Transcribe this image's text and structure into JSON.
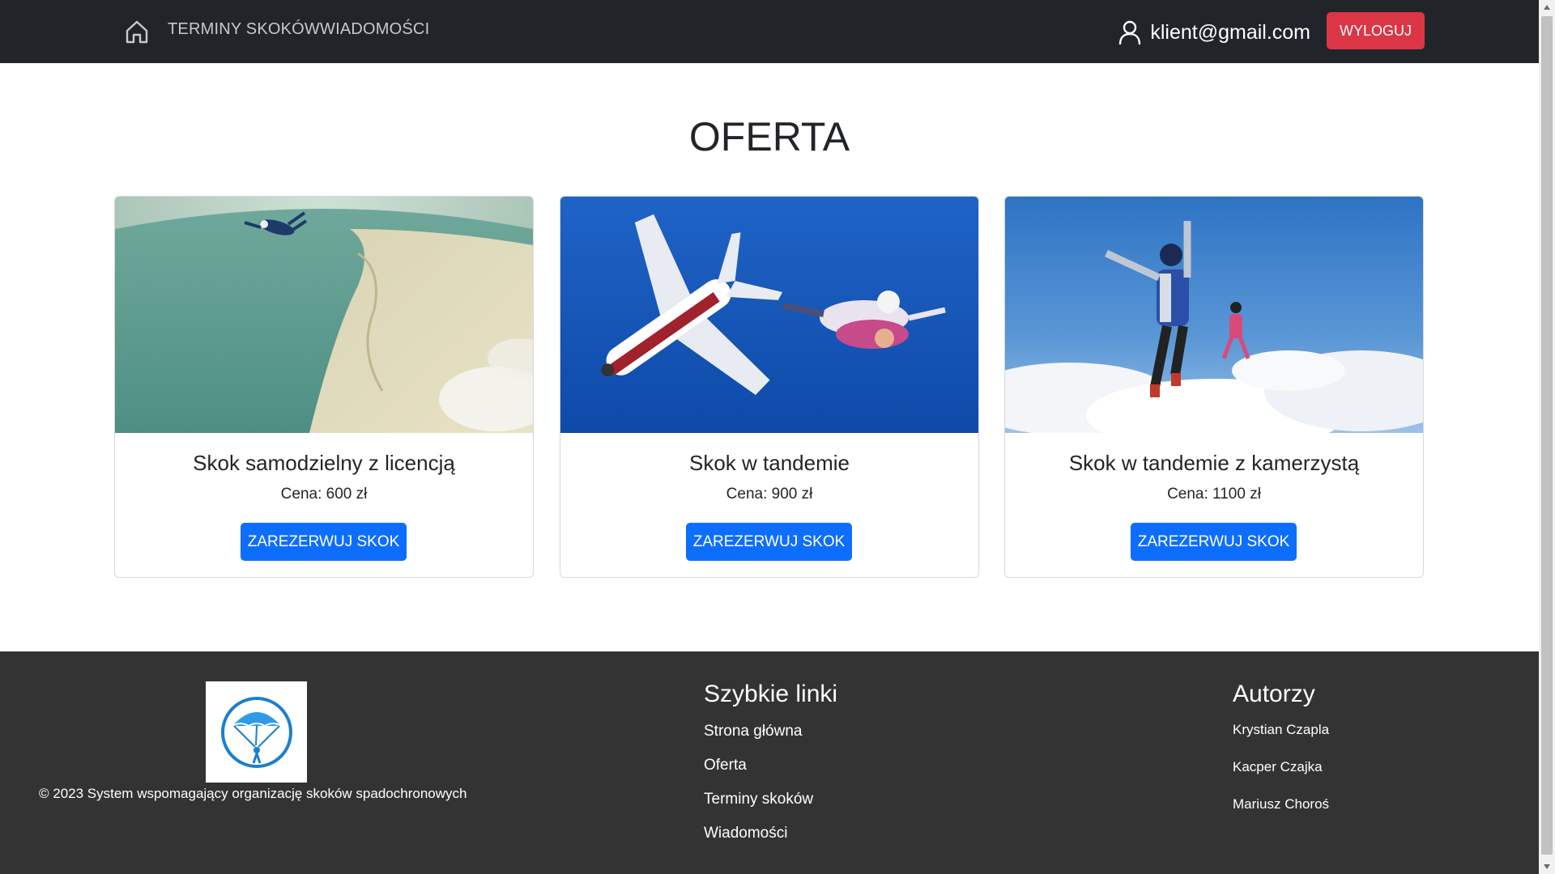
{
  "navbar": {
    "home_icon": "home-icon",
    "links": [
      {
        "label": "TERMINY SKOKÓW"
      },
      {
        "label": "WIADOMOŚCI"
      }
    ],
    "user_icon": "user-icon",
    "user_email": "klient@gmail.com",
    "logout_label": "WYLOGUJ"
  },
  "main": {
    "title": "OFERTA",
    "cards": [
      {
        "title": "Skok samodzielny z licencją",
        "price": "Cena: 600 zł",
        "button": "ZAREZERWUJ SKOK"
      },
      {
        "title": "Skok w tandemie",
        "price": "Cena: 900 zł",
        "button": "ZAREZERWUJ SKOK"
      },
      {
        "title": "Skok w tandemie z kamerzystą",
        "price": "Cena: 1100 zł",
        "button": "ZAREZERWUJ SKOK"
      }
    ]
  },
  "footer": {
    "logo_icon": "parachute-icon",
    "copyright": "© 2023 System wspomagający organizację skoków spadochronowych",
    "quick_links": {
      "heading": "Szybkie linki",
      "items": [
        "Strona główna",
        "Oferta",
        "Terminy skoków",
        "Wiadomości"
      ]
    },
    "authors": {
      "heading": "Autorzy",
      "items": [
        "Krystian Czapla",
        "Kacper Czajka",
        "Mariusz Choroś"
      ]
    }
  },
  "colors": {
    "navbar_bg": "#212529",
    "logout_bg": "#dc3545",
    "primary": "#0d6efd",
    "footer_bg": "#333333"
  }
}
